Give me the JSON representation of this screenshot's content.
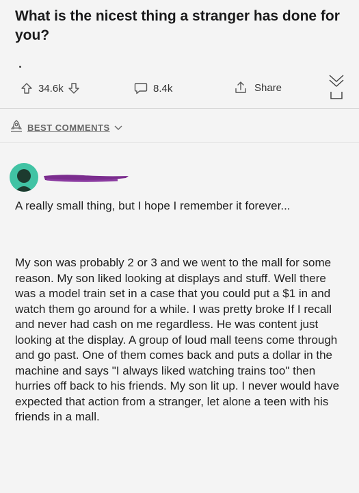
{
  "post": {
    "title": "What is the nicest thing a stranger has done for you?",
    "upvotes": "34.6k",
    "comments": "8.4k",
    "share_label": "Share"
  },
  "sort": {
    "label": "BEST COMMENTS"
  },
  "comment": {
    "paragraphs": [
      "A really small thing, but I hope I remember it forever...",
      "My son was probably 2 or 3 and we went to the mall for some reason. My son liked looking at displays and stuff. Well there was a model train set in a case that you could put a $1 in and watch them go around for a while. I was pretty broke If I recall and never had cash on me regardless. He was content just looking at the display. A group of loud mall teens come through and go past. One of them comes back and puts a dollar in the machine and says \"I always liked watching trains too\" then hurries off back to his friends. My son lit up. I never would have expected that action from a stranger, let alone a teen with his friends in a mall."
    ]
  },
  "colors": {
    "avatar": "#41c3a4",
    "redaction": "#7b2d8e",
    "background": "#f4f4f4"
  }
}
